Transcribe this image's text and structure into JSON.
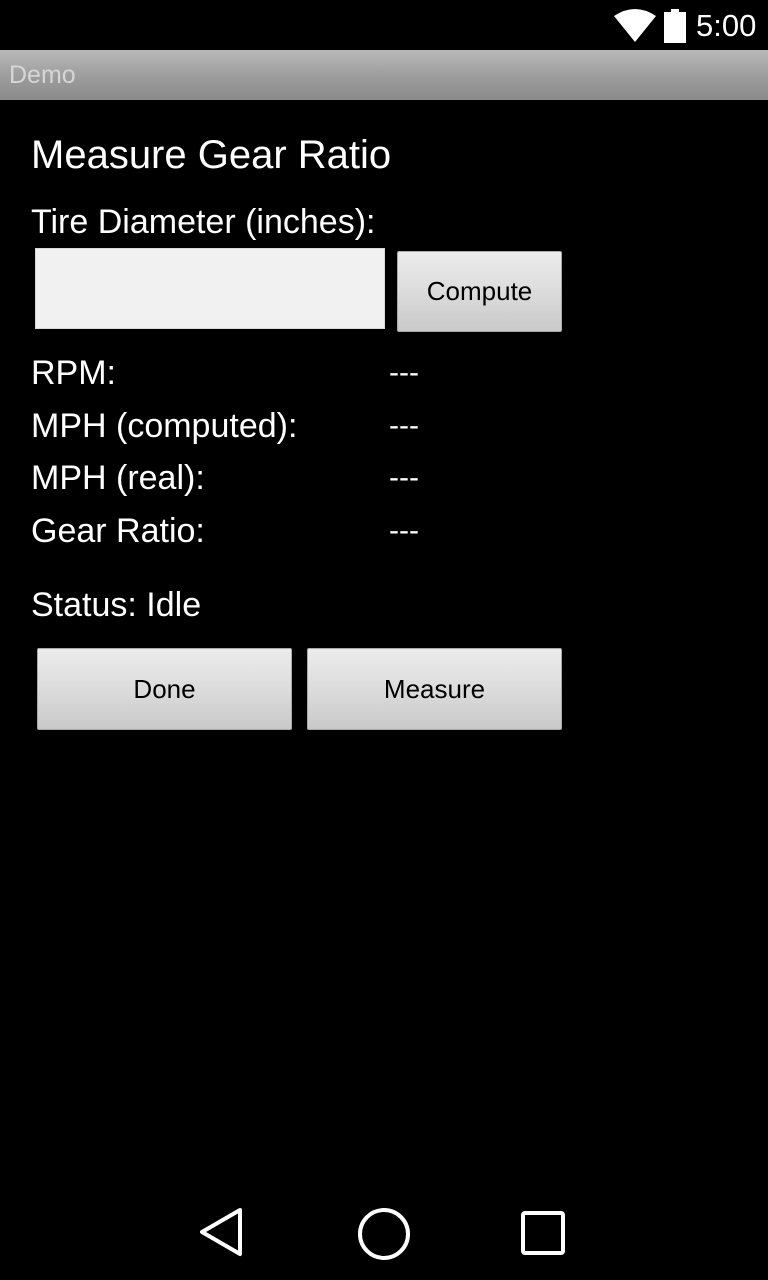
{
  "status_bar": {
    "time": "5:00",
    "icons": [
      "wifi-icon",
      "battery-icon"
    ]
  },
  "action_bar": {
    "title": "Demo"
  },
  "main": {
    "title": "Measure Gear Ratio",
    "tire_label": "Tire Diameter (inches):",
    "tire_input": {
      "value": "",
      "placeholder": ""
    },
    "compute_label": "Compute",
    "rows": [
      {
        "label": "RPM:",
        "value": "---"
      },
      {
        "label": "MPH (computed):",
        "value": "---"
      },
      {
        "label": "MPH (real):",
        "value": "---"
      },
      {
        "label": "Gear Ratio:",
        "value": "---"
      }
    ],
    "status": "Status: Idle",
    "done_label": "Done",
    "measure_label": "Measure"
  },
  "nav_bar": {
    "icons": [
      "back-icon",
      "home-icon",
      "recent-apps-icon"
    ]
  },
  "colors": {
    "background": "#000000",
    "text": "#ffffff",
    "action_bar": "#9c9c9c",
    "button": "#dcdcdc",
    "input": "#f1f1f1"
  }
}
